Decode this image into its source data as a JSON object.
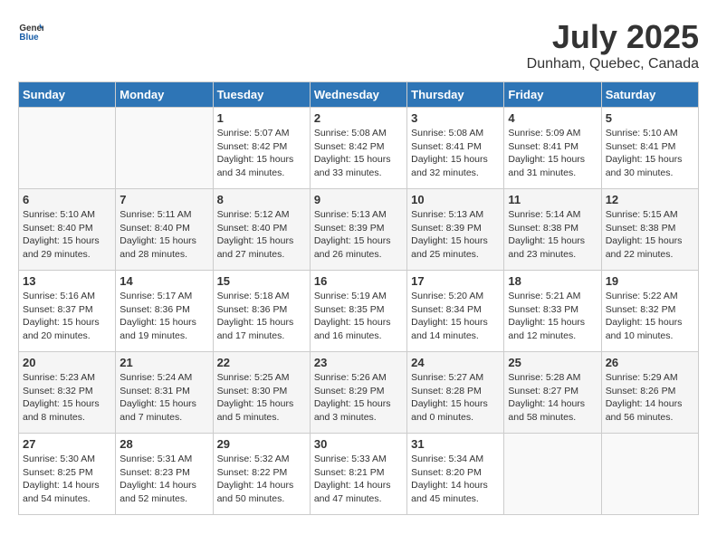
{
  "header": {
    "logo_general": "General",
    "logo_blue": "Blue",
    "month_year": "July 2025",
    "location": "Dunham, Quebec, Canada"
  },
  "weekdays": [
    "Sunday",
    "Monday",
    "Tuesday",
    "Wednesday",
    "Thursday",
    "Friday",
    "Saturday"
  ],
  "weeks": [
    [
      {
        "day": "",
        "sunrise": "",
        "sunset": "",
        "daylight": ""
      },
      {
        "day": "",
        "sunrise": "",
        "sunset": "",
        "daylight": ""
      },
      {
        "day": "1",
        "sunrise": "Sunrise: 5:07 AM",
        "sunset": "Sunset: 8:42 PM",
        "daylight": "Daylight: 15 hours and 34 minutes."
      },
      {
        "day": "2",
        "sunrise": "Sunrise: 5:08 AM",
        "sunset": "Sunset: 8:42 PM",
        "daylight": "Daylight: 15 hours and 33 minutes."
      },
      {
        "day": "3",
        "sunrise": "Sunrise: 5:08 AM",
        "sunset": "Sunset: 8:41 PM",
        "daylight": "Daylight: 15 hours and 32 minutes."
      },
      {
        "day": "4",
        "sunrise": "Sunrise: 5:09 AM",
        "sunset": "Sunset: 8:41 PM",
        "daylight": "Daylight: 15 hours and 31 minutes."
      },
      {
        "day": "5",
        "sunrise": "Sunrise: 5:10 AM",
        "sunset": "Sunset: 8:41 PM",
        "daylight": "Daylight: 15 hours and 30 minutes."
      }
    ],
    [
      {
        "day": "6",
        "sunrise": "Sunrise: 5:10 AM",
        "sunset": "Sunset: 8:40 PM",
        "daylight": "Daylight: 15 hours and 29 minutes."
      },
      {
        "day": "7",
        "sunrise": "Sunrise: 5:11 AM",
        "sunset": "Sunset: 8:40 PM",
        "daylight": "Daylight: 15 hours and 28 minutes."
      },
      {
        "day": "8",
        "sunrise": "Sunrise: 5:12 AM",
        "sunset": "Sunset: 8:40 PM",
        "daylight": "Daylight: 15 hours and 27 minutes."
      },
      {
        "day": "9",
        "sunrise": "Sunrise: 5:13 AM",
        "sunset": "Sunset: 8:39 PM",
        "daylight": "Daylight: 15 hours and 26 minutes."
      },
      {
        "day": "10",
        "sunrise": "Sunrise: 5:13 AM",
        "sunset": "Sunset: 8:39 PM",
        "daylight": "Daylight: 15 hours and 25 minutes."
      },
      {
        "day": "11",
        "sunrise": "Sunrise: 5:14 AM",
        "sunset": "Sunset: 8:38 PM",
        "daylight": "Daylight: 15 hours and 23 minutes."
      },
      {
        "day": "12",
        "sunrise": "Sunrise: 5:15 AM",
        "sunset": "Sunset: 8:38 PM",
        "daylight": "Daylight: 15 hours and 22 minutes."
      }
    ],
    [
      {
        "day": "13",
        "sunrise": "Sunrise: 5:16 AM",
        "sunset": "Sunset: 8:37 PM",
        "daylight": "Daylight: 15 hours and 20 minutes."
      },
      {
        "day": "14",
        "sunrise": "Sunrise: 5:17 AM",
        "sunset": "Sunset: 8:36 PM",
        "daylight": "Daylight: 15 hours and 19 minutes."
      },
      {
        "day": "15",
        "sunrise": "Sunrise: 5:18 AM",
        "sunset": "Sunset: 8:36 PM",
        "daylight": "Daylight: 15 hours and 17 minutes."
      },
      {
        "day": "16",
        "sunrise": "Sunrise: 5:19 AM",
        "sunset": "Sunset: 8:35 PM",
        "daylight": "Daylight: 15 hours and 16 minutes."
      },
      {
        "day": "17",
        "sunrise": "Sunrise: 5:20 AM",
        "sunset": "Sunset: 8:34 PM",
        "daylight": "Daylight: 15 hours and 14 minutes."
      },
      {
        "day": "18",
        "sunrise": "Sunrise: 5:21 AM",
        "sunset": "Sunset: 8:33 PM",
        "daylight": "Daylight: 15 hours and 12 minutes."
      },
      {
        "day": "19",
        "sunrise": "Sunrise: 5:22 AM",
        "sunset": "Sunset: 8:32 PM",
        "daylight": "Daylight: 15 hours and 10 minutes."
      }
    ],
    [
      {
        "day": "20",
        "sunrise": "Sunrise: 5:23 AM",
        "sunset": "Sunset: 8:32 PM",
        "daylight": "Daylight: 15 hours and 8 minutes."
      },
      {
        "day": "21",
        "sunrise": "Sunrise: 5:24 AM",
        "sunset": "Sunset: 8:31 PM",
        "daylight": "Daylight: 15 hours and 7 minutes."
      },
      {
        "day": "22",
        "sunrise": "Sunrise: 5:25 AM",
        "sunset": "Sunset: 8:30 PM",
        "daylight": "Daylight: 15 hours and 5 minutes."
      },
      {
        "day": "23",
        "sunrise": "Sunrise: 5:26 AM",
        "sunset": "Sunset: 8:29 PM",
        "daylight": "Daylight: 15 hours and 3 minutes."
      },
      {
        "day": "24",
        "sunrise": "Sunrise: 5:27 AM",
        "sunset": "Sunset: 8:28 PM",
        "daylight": "Daylight: 15 hours and 0 minutes."
      },
      {
        "day": "25",
        "sunrise": "Sunrise: 5:28 AM",
        "sunset": "Sunset: 8:27 PM",
        "daylight": "Daylight: 14 hours and 58 minutes."
      },
      {
        "day": "26",
        "sunrise": "Sunrise: 5:29 AM",
        "sunset": "Sunset: 8:26 PM",
        "daylight": "Daylight: 14 hours and 56 minutes."
      }
    ],
    [
      {
        "day": "27",
        "sunrise": "Sunrise: 5:30 AM",
        "sunset": "Sunset: 8:25 PM",
        "daylight": "Daylight: 14 hours and 54 minutes."
      },
      {
        "day": "28",
        "sunrise": "Sunrise: 5:31 AM",
        "sunset": "Sunset: 8:23 PM",
        "daylight": "Daylight: 14 hours and 52 minutes."
      },
      {
        "day": "29",
        "sunrise": "Sunrise: 5:32 AM",
        "sunset": "Sunset: 8:22 PM",
        "daylight": "Daylight: 14 hours and 50 minutes."
      },
      {
        "day": "30",
        "sunrise": "Sunrise: 5:33 AM",
        "sunset": "Sunset: 8:21 PM",
        "daylight": "Daylight: 14 hours and 47 minutes."
      },
      {
        "day": "31",
        "sunrise": "Sunrise: 5:34 AM",
        "sunset": "Sunset: 8:20 PM",
        "daylight": "Daylight: 14 hours and 45 minutes."
      },
      {
        "day": "",
        "sunrise": "",
        "sunset": "",
        "daylight": ""
      },
      {
        "day": "",
        "sunrise": "",
        "sunset": "",
        "daylight": ""
      }
    ]
  ]
}
